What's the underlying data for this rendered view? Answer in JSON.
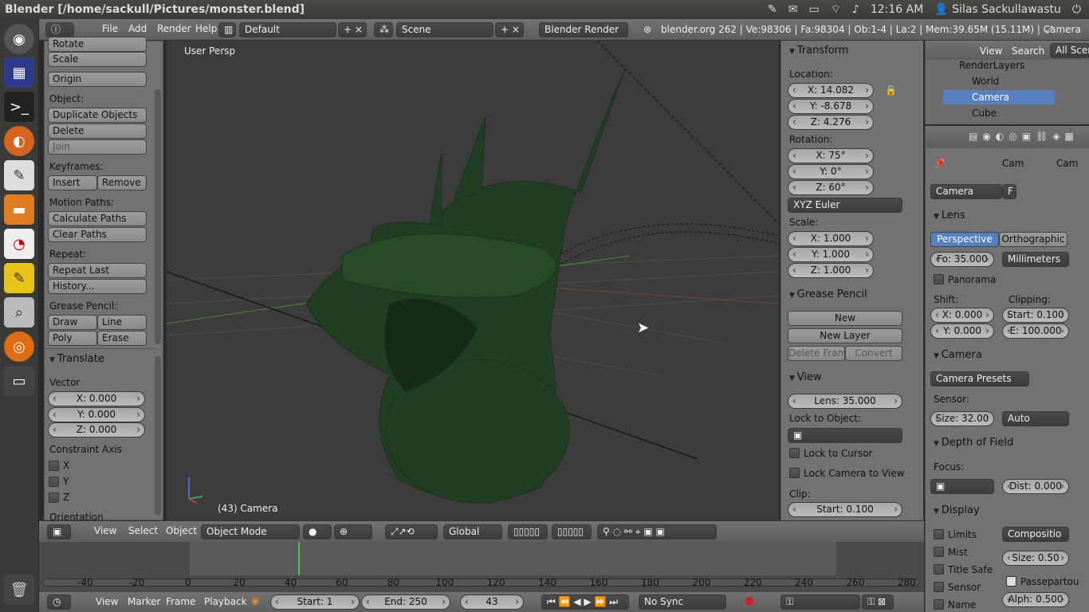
{
  "window_title": "Blender [/home/sackull/Pictures/monster.blend]",
  "tray": {
    "time": "12:16 AM",
    "user": "Silas Sackullawastu"
  },
  "menu": {
    "file": "File",
    "add": "Add",
    "render": "Render",
    "help": "Help"
  },
  "screen_layout": "Default",
  "scene_name": "Scene",
  "render_engine": "Blender Render",
  "info_text": "blender.org 262 | Ve:98306 | Fa:98304 | Ob:1-4 | La:2 | Mem:39.65M (15.11M) | Camera",
  "tools": {
    "rotate": "Rotate",
    "scale": "Scale",
    "origin": "Origin",
    "object_label": "Object:",
    "duplicate": "Duplicate Objects",
    "delete": "Delete",
    "join": "Join",
    "keyframes_label": "Keyframes:",
    "insert": "Insert",
    "remove": "Remove",
    "motion_label": "Motion Paths:",
    "calc_paths": "Calculate Paths",
    "clear_paths": "Clear Paths",
    "repeat_label": "Repeat:",
    "repeat_last": "Repeat Last",
    "history": "History...",
    "grease_label": "Grease Pencil:",
    "draw": "Draw",
    "line": "Line",
    "poly": "Poly",
    "erase": "Erase"
  },
  "translate": {
    "header": "Translate",
    "vector_label": "Vector",
    "x": "X: 0.000",
    "y": "Y: 0.000",
    "z": "Z: 0.000",
    "constraint_label": "Constraint Axis",
    "cx": "X",
    "cy": "Y",
    "cz": "Z",
    "orientation_label": "Orientation"
  },
  "viewport": {
    "view_name": "User Persp",
    "object_label": "(43) Camera"
  },
  "transform": {
    "header": "Transform",
    "location_label": "Location:",
    "loc_x": "X: 14.082",
    "loc_y": "Y: -8.678",
    "loc_z": "Z: 4.276",
    "rotation_label": "Rotation:",
    "rot_x": "X: 75°",
    "rot_y": "Y: 0°",
    "rot_z": "Z: 60°",
    "rot_mode": "XYZ Euler",
    "scale_label": "Scale:",
    "sc_x": "X: 1.000",
    "sc_y": "Y: 1.000",
    "sc_z": "Z: 1.000"
  },
  "grease_pencil": {
    "header": "Grease Pencil",
    "new": "New",
    "new_layer": "New Layer",
    "delete_frame": "Delete Frame",
    "convert": "Convert"
  },
  "view_panel": {
    "header": "View",
    "lens": "Lens: 35.000",
    "lock_obj_label": "Lock to Object:",
    "lock_cursor": "Lock to Cursor",
    "lock_camera": "Lock Camera to View",
    "clip_label": "Clip:",
    "clip_start": "Start: 0.100"
  },
  "outliner": {
    "view": "View",
    "search": "Search",
    "all_scenes": "All Scene",
    "items": [
      "RenderLayers",
      "World",
      "Camera",
      "Cube"
    ]
  },
  "props": {
    "crumb_cam1": "Cam",
    "crumb_cam2": "Cam",
    "data_name": "Camera",
    "fake_user": "F",
    "lens_header": "Lens",
    "perspective": "Perspective",
    "orthographic": "Orthographic",
    "focal": "Fo: 35.000",
    "units": "Millimeters",
    "panorama": "Panorama",
    "shift_label": "Shift:",
    "clipping_label": "Clipping:",
    "shift_x": "X: 0.000",
    "shift_y": "Y: 0.000",
    "clip_start": "Start: 0.100",
    "clip_end": "E: 100.000",
    "camera_header": "Camera",
    "presets": "Camera Presets",
    "sensor_label": "Sensor:",
    "sensor_size": "Size: 32.00",
    "sensor_fit": "Auto",
    "dof_header": "Depth of Field",
    "focus_label": "Focus:",
    "dist": "Dist: 0.000",
    "display_header": "Display",
    "limits": "Limits",
    "composition": "Compositio",
    "mist": "Mist",
    "display_size": "Size: 0.50",
    "title_safe": "Title Safe",
    "passepartout": "Passepartou",
    "sensor": "Sensor",
    "alpha": "Alph: 0.500",
    "name": "Name"
  },
  "vp_header": {
    "view": "View",
    "select": "Select",
    "object": "Object",
    "mode": "Object Mode",
    "orientation": "Global"
  },
  "timeline": {
    "ticks": [
      "-40",
      "-20",
      "0",
      "20",
      "40",
      "60",
      "80",
      "100",
      "120",
      "140",
      "160",
      "180",
      "200",
      "220",
      "240",
      "260",
      "280"
    ],
    "current_frame_marker": 43
  },
  "tl_header": {
    "view": "View",
    "marker": "Marker",
    "frame": "Frame",
    "playback": "Playback",
    "start": "Start: 1",
    "end": "End: 250",
    "current": "43",
    "sync": "No Sync"
  }
}
